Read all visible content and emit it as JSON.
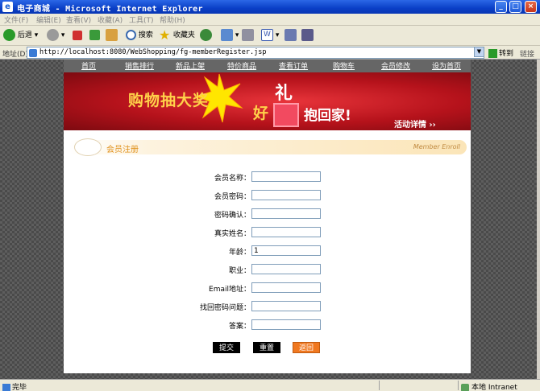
{
  "window": {
    "title": "电子商城 - Microsoft Internet Explorer"
  },
  "menu": [
    "文件(F)",
    "编辑(E)",
    "查看(V)",
    "收藏(A)",
    "工具(T)",
    "帮助(H)"
  ],
  "toolbar": {
    "back": "后退",
    "search": "搜索",
    "favorites": "收藏夹"
  },
  "address": {
    "label": "地址(D)",
    "url": "http://localhost:8080/WebShopping/fg-memberRegister.jsp",
    "go": "转到",
    "links": "链接"
  },
  "nav": [
    "首页",
    "销售排行",
    "新品上架",
    "特价商品",
    "查看订单",
    "购物车",
    "会员修改",
    "设为首页"
  ],
  "banner": {
    "line1": "购物抽大奖",
    "li": "礼",
    "hao": "好",
    "line2": "抱回家!",
    "activity": "活动详情 ››"
  },
  "section": {
    "title": "会员注册",
    "subtitle": "Member Enroll"
  },
  "form": {
    "fields": [
      {
        "label": "会员名称：",
        "value": ""
      },
      {
        "label": "会员密码：",
        "value": ""
      },
      {
        "label": "密码确认：",
        "value": ""
      },
      {
        "label": "真实姓名：",
        "value": ""
      },
      {
        "label": "年龄：",
        "value": "1"
      },
      {
        "label": "职业：",
        "value": ""
      },
      {
        "label": "Email地址：",
        "value": ""
      },
      {
        "label": "找回密码问题：",
        "value": ""
      },
      {
        "label": "答案：",
        "value": ""
      }
    ],
    "submit": "提交",
    "reset": "重置",
    "back": "返回"
  },
  "status": {
    "text": "完毕",
    "zone": "本地 Intranet"
  }
}
